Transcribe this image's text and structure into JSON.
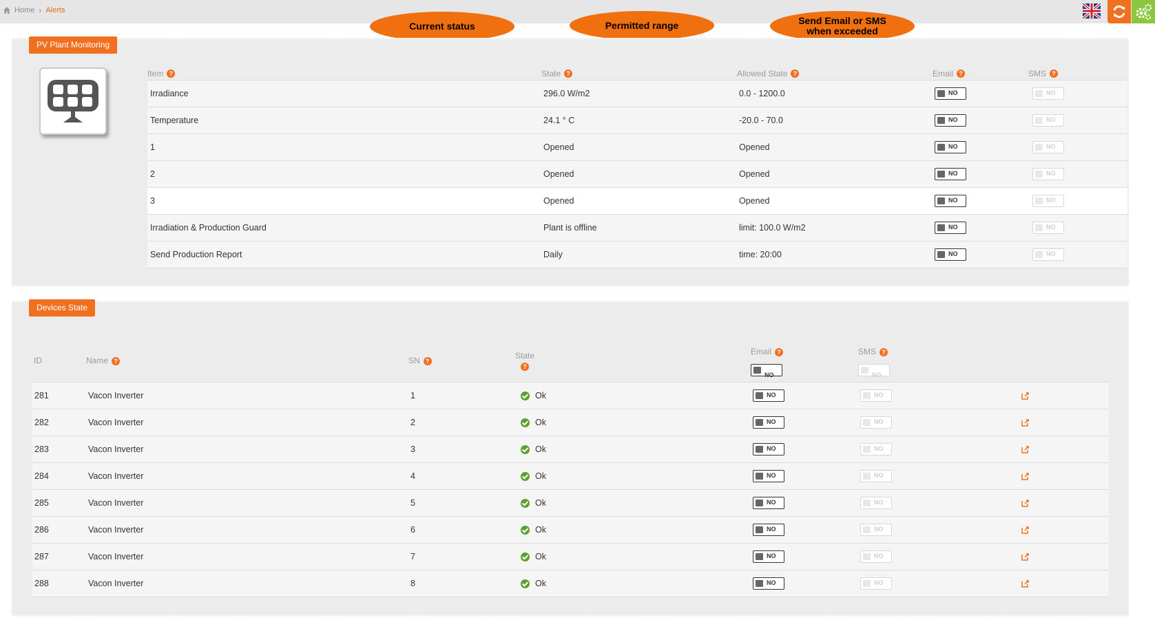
{
  "breadcrumb": {
    "home": "Home",
    "current": "Alerts"
  },
  "callouts": {
    "current_status": "Current status",
    "permitted_range": "Permitted range",
    "send_line1": "Send Email or SMS",
    "send_line2": "when exceeded"
  },
  "plant": {
    "title": "PV Plant Monitoring",
    "headers": {
      "item": "Item",
      "state": "State",
      "allowed": "Allowed State",
      "email": "Email",
      "sms": "SMS"
    },
    "rows": [
      {
        "item": "Irradiance",
        "state": "296.0 W/m2",
        "allowed": "0.0 - 1200.0",
        "email": "NO",
        "sms": "NO"
      },
      {
        "item": "Temperature",
        "state": "24.1 ° C",
        "allowed": "-20.0 - 70.0",
        "email": "NO",
        "sms": "NO"
      },
      {
        "item": "1",
        "state": "Opened",
        "allowed": "Opened",
        "email": "NO",
        "sms": "NO"
      },
      {
        "item": "2",
        "state": "Opened",
        "allowed": "Opened",
        "email": "NO",
        "sms": "NO"
      },
      {
        "item": "3",
        "state": "Opened",
        "allowed": "Opened",
        "email": "NO",
        "sms": "NO"
      },
      {
        "item": "Irradiation & Production Guard",
        "state": "Plant is offline",
        "allowed": "limit: 100.0 W/m2",
        "email": "NO",
        "sms": "NO"
      },
      {
        "item": "Send Production Report",
        "state": "Daily",
        "allowed": "time: 20:00",
        "email": "NO",
        "sms": "NO"
      }
    ]
  },
  "devices": {
    "title": "Devices State",
    "headers": {
      "id": "ID",
      "name": "Name",
      "sn": "SN",
      "state": "State",
      "email": "Email",
      "sms": "SMS"
    },
    "header_email_toggle": "NO",
    "header_sms_toggle": "NO",
    "rows": [
      {
        "id": "281",
        "name": "Vacon Inverter",
        "sn": "1",
        "state": "Ok",
        "email": "NO",
        "sms": "NO"
      },
      {
        "id": "282",
        "name": "Vacon Inverter",
        "sn": "2",
        "state": "Ok",
        "email": "NO",
        "sms": "NO"
      },
      {
        "id": "283",
        "name": "Vacon Inverter",
        "sn": "3",
        "state": "Ok",
        "email": "NO",
        "sms": "NO"
      },
      {
        "id": "284",
        "name": "Vacon Inverter",
        "sn": "4",
        "state": "Ok",
        "email": "NO",
        "sms": "NO"
      },
      {
        "id": "285",
        "name": "Vacon Inverter",
        "sn": "5",
        "state": "Ok",
        "email": "NO",
        "sms": "NO"
      },
      {
        "id": "286",
        "name": "Vacon Inverter",
        "sn": "6",
        "state": "Ok",
        "email": "NO",
        "sms": "NO"
      },
      {
        "id": "287",
        "name": "Vacon Inverter",
        "sn": "7",
        "state": "Ok",
        "email": "NO",
        "sms": "NO"
      },
      {
        "id": "288",
        "name": "Vacon Inverter",
        "sn": "8",
        "state": "Ok",
        "email": "NO",
        "sms": "NO"
      }
    ]
  },
  "colors": {
    "accent": "#f07020",
    "ok": "#5aa130",
    "settings": "#8cc63f"
  },
  "icons": [
    "home-icon",
    "chevron-right-icon",
    "uk-flag-icon",
    "refresh-icon",
    "settings-icon",
    "solar-panel-icon",
    "help-icon",
    "ok-icon",
    "external-link-icon"
  ]
}
